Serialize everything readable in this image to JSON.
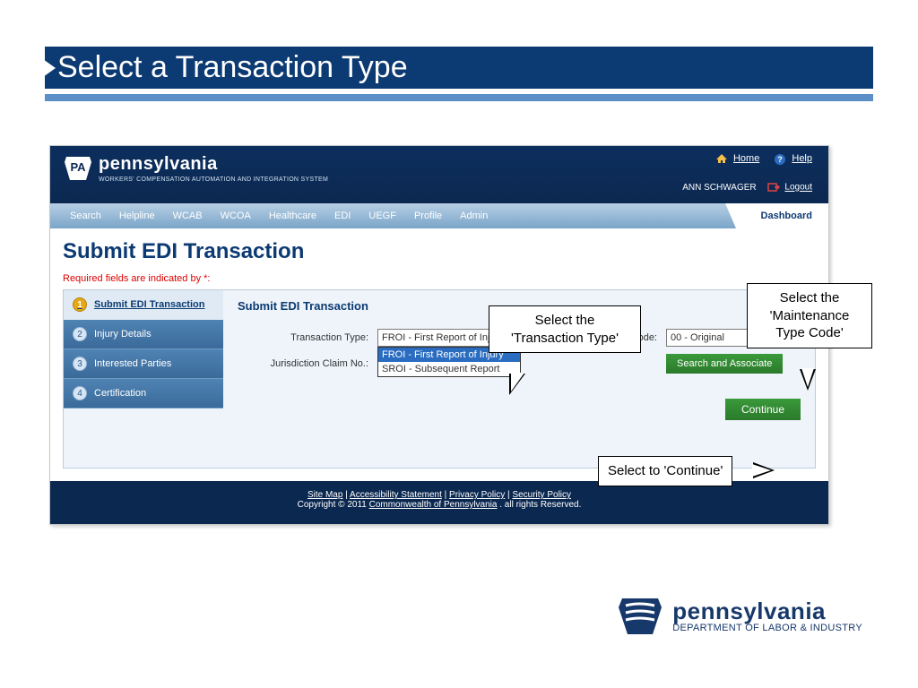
{
  "slide": {
    "title": "Select a Transaction Type"
  },
  "app": {
    "brand_state": "pennsylvania",
    "brand_sub": "WORKERS' COMPENSATION AUTOMATION AND INTEGRATION SYSTEM",
    "header_links": {
      "home": "Home",
      "help": "Help",
      "logout": "Logout"
    },
    "user": "ANN SCHWAGER",
    "nav": [
      "Search",
      "Helpline",
      "WCAB",
      "WCOA",
      "Healthcare",
      "EDI",
      "UEGF",
      "Profile",
      "Admin"
    ],
    "dashboard_label": "Dashboard"
  },
  "page": {
    "title": "Submit EDI Transaction",
    "required_note": "Required fields are indicated by *:",
    "wizard": [
      {
        "num": "1",
        "label": "Submit EDI Transaction"
      },
      {
        "num": "2",
        "label": "Injury Details"
      },
      {
        "num": "3",
        "label": "Interested Parties"
      },
      {
        "num": "4",
        "label": "Certification"
      }
    ],
    "form": {
      "heading": "Submit EDI Transaction",
      "transaction_type_label": "Transaction Type:",
      "transaction_type_value": "FROI - First Report of Inju",
      "transaction_type_options": [
        "FROI - First Report of Injury",
        "SROI - Subsequent Report"
      ],
      "maintenance_label": "Maintenance Type Code:",
      "maintenance_value": "00 - Original",
      "jurisdiction_label": "Jurisdiction Claim No.:",
      "search_btn": "Search and Associate",
      "continue_btn": "Continue"
    }
  },
  "callouts": {
    "txn": "Select the\n'Transaction Type'",
    "maint": "Select the\n'Maintenance\nType Code'",
    "cont": "Select to 'Continue'"
  },
  "footer": {
    "links": [
      "Site Map",
      "Accessibility Statement",
      "Privacy Policy",
      "Security Policy"
    ],
    "copyright_pre": "Copyright © 2011 ",
    "copyright_link": "Commonwealth of Pennsylvania",
    "copyright_post": " . all rights Reserved."
  },
  "dept_logo": {
    "name": "pennsylvania",
    "dept": "DEPARTMENT OF LABOR & INDUSTRY"
  }
}
